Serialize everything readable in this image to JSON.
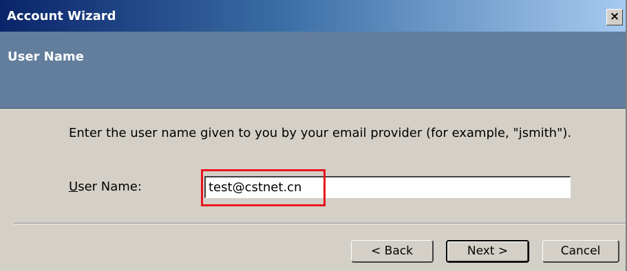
{
  "window": {
    "title": "Account Wizard",
    "close_label": "×"
  },
  "header": {
    "title": "User Name"
  },
  "content": {
    "instructions": "Enter the user name given to you by your email provider (for example, \"jsmith\").",
    "username_label_first": "U",
    "username_label_rest": "ser Name:",
    "username_value": "test@cstnet.cn"
  },
  "buttons": {
    "back": "< Back",
    "next": "Next >",
    "cancel": "Cancel"
  },
  "colors": {
    "title_bar": "#0a246a",
    "header_band": "#627e9c",
    "dialog_bg": "#d4d0c8",
    "highlight": "#e8141c"
  }
}
